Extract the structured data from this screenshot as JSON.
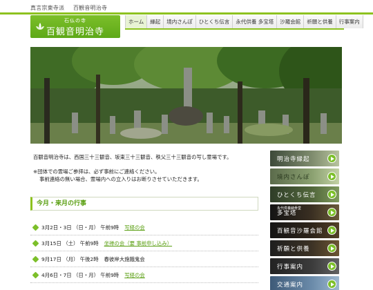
{
  "header": {
    "sect": "真言宗東寺派",
    "temple": "百観音明治寺",
    "logo_small": "石仏の寺",
    "logo_name": "百観音明治寺"
  },
  "nav": [
    "ホーム",
    "縁起",
    "境内さんぽ",
    "ひとくち伝言",
    "永代供養 多宝塔",
    "沙羅会館",
    "祈願と供養",
    "行事案内"
  ],
  "intro": "百観音明治寺は、西国三十三観音、坂東三十三観音、秩父三十三観音の写し霊場です。",
  "notice": {
    "line1": "※団体での霊場ご参拝は、必ず事前にご連絡ください。",
    "line2": "事前連絡の無い場合、霊場内への立入りはお断りさせていただきます。"
  },
  "events_title": "今月・来月の行事",
  "events": [
    {
      "date": "3月2日・3日 （日・月） 午前9時",
      "link": "写経の会",
      "text": ""
    },
    {
      "date": "3月15日 （土） 午前9時",
      "link": "坐禅の会（要 事前申し込み）",
      "text": ""
    },
    {
      "date": "9月17日 （月） 午後2時",
      "link": "",
      "text": "春彼岸大施餓鬼会"
    },
    {
      "date": "4月6日・7日 （日・月） 午前9時",
      "link": "写経の会",
      "text": ""
    }
  ],
  "sidebar": [
    {
      "label": "明治寺縁起",
      "sub": ""
    },
    {
      "label": "境内さんぽ",
      "sub": ""
    },
    {
      "label": "ひとくち伝言",
      "sub": ""
    },
    {
      "label": "多宝塔",
      "sub": "永代供養納骨堂"
    },
    {
      "label": "百観音沙羅会館",
      "sub": ""
    },
    {
      "label": "祈願と供養",
      "sub": ""
    },
    {
      "label": "行事案内",
      "sub": ""
    },
    {
      "label": "交通案内",
      "sub": ""
    }
  ],
  "colors": {
    "accent": "#8dc21f",
    "accent_dark": "#5a9f12"
  }
}
